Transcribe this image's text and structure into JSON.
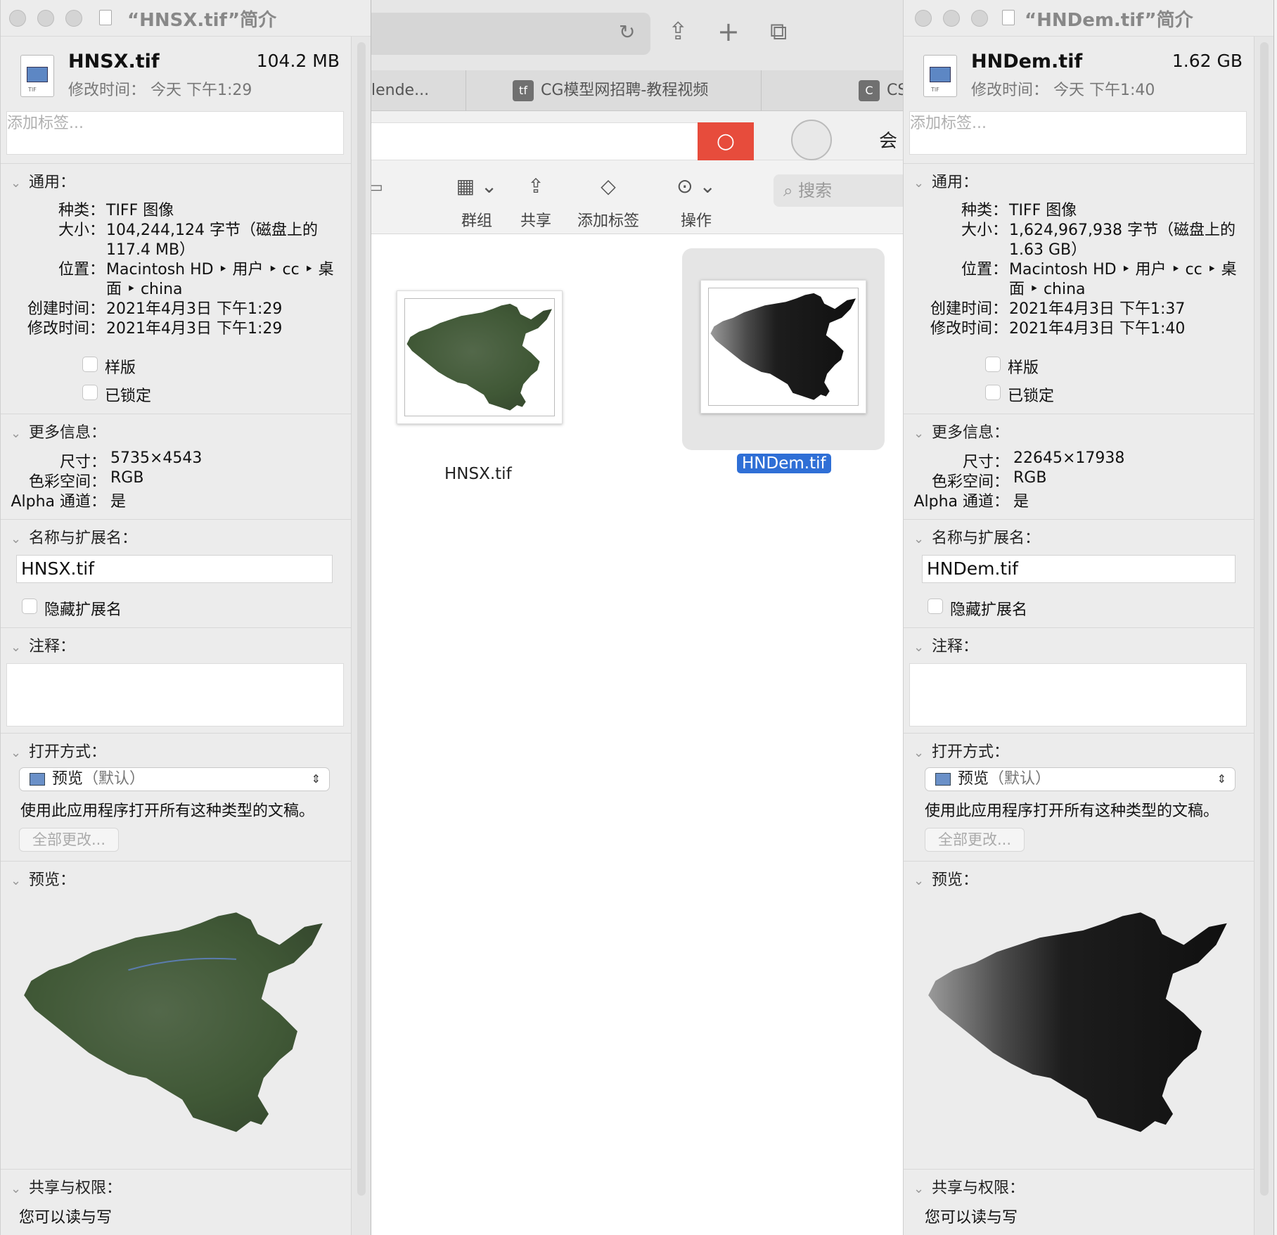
{
  "colors": {
    "window_bg": "#ececec",
    "selection_blue": "#2f6fd6",
    "search_red": "#e74c3c",
    "satellite_green": "#3f5a35",
    "dem_dark": "#151515"
  },
  "browser": {
    "tabs": [
      {
        "label": "lende...",
        "icon": "generic-tab"
      },
      {
        "label": "CG模型网招聘-教程视频",
        "icon": "cg-logo-icon"
      },
      {
        "label": "CS",
        "icon": "c-logo-icon"
      }
    ],
    "icons": [
      "reload-icon",
      "share-icon",
      "new-tab-icon",
      "tab-overview-icon"
    ],
    "web_header_text": "会"
  },
  "finder": {
    "toolbar": {
      "group": "群组",
      "share": "共享",
      "add_tag": "添加标签",
      "action": "操作",
      "search_placeholder": "搜索"
    },
    "files": [
      {
        "name": "HNSX.tif",
        "selected": false
      },
      {
        "name": "HNDem.tif",
        "selected": true
      }
    ]
  },
  "info_left": {
    "window_title": "“HNSX.tif”简介",
    "file_name": "HNSX.tif",
    "file_size": "104.2 MB",
    "modified_short": "修改时间： 今天 下午1:29",
    "tag_placeholder": "添加标签...",
    "general": {
      "header": "通用：",
      "kind_label": "种类：",
      "kind": "TIFF 图像",
      "size_label": "大小：",
      "size_line1": "104,244,124 字节（磁盘上的",
      "size_line2": "117.4 MB）",
      "where_label": "位置：",
      "where_line1": "Macintosh HD ‣ 用户 ‣ cc ‣ 桌",
      "where_line2": "面 ‣ china",
      "created_label": "创建时间：",
      "created": "2021年4月3日 下午1:29",
      "modified_label": "修改时间：",
      "modified": "2021年4月3日 下午1:29",
      "stationery": "样版",
      "locked": "已锁定"
    },
    "more": {
      "header": "更多信息：",
      "dim_label": "尺寸：",
      "dimensions": "5735×4543",
      "cs_label": "色彩空间：",
      "color_space": "RGB",
      "alpha_label": "Alpha 通道：",
      "alpha": "是"
    },
    "name_ext": {
      "header": "名称与扩展名：",
      "value": "HNSX.tif",
      "hide_ext": "隐藏扩展名"
    },
    "comments": {
      "header": "注释："
    },
    "open_with": {
      "header": "打开方式：",
      "app": "预览",
      "app_default": "（默认）",
      "note": "使用此应用程序打开所有这种类型的文稿。",
      "change_all": "全部更改..."
    },
    "preview": {
      "header": "预览："
    },
    "sharing": {
      "header": "共享与权限：",
      "note": "您可以读与写"
    }
  },
  "info_right": {
    "window_title": "“HNDem.tif”简介",
    "file_name": "HNDem.tif",
    "file_size": "1.62 GB",
    "modified_short": "修改时间： 今天 下午1:40",
    "tag_placeholder": "添加标签...",
    "general": {
      "header": "通用：",
      "kind_label": "种类：",
      "kind": "TIFF 图像",
      "size_label": "大小：",
      "size_line1": "1,624,967,938 字节（磁盘上的",
      "size_line2": "1.63 GB）",
      "where_label": "位置：",
      "where_line1": "Macintosh HD ‣ 用户 ‣ cc ‣ 桌",
      "where_line2": "面 ‣ china",
      "created_label": "创建时间：",
      "created": "2021年4月3日 下午1:37",
      "modified_label": "修改时间：",
      "modified": "2021年4月3日 下午1:40",
      "stationery": "样版",
      "locked": "已锁定"
    },
    "more": {
      "header": "更多信息：",
      "dim_label": "尺寸：",
      "dimensions": "22645×17938",
      "cs_label": "色彩空间：",
      "color_space": "RGB",
      "alpha_label": "Alpha 通道：",
      "alpha": "是"
    },
    "name_ext": {
      "header": "名称与扩展名：",
      "value": "HNDem.tif",
      "hide_ext": "隐藏扩展名"
    },
    "comments": {
      "header": "注释："
    },
    "open_with": {
      "header": "打开方式：",
      "app": "预览",
      "app_default": "（默认）",
      "note": "使用此应用程序打开所有这种类型的文稿。",
      "change_all": "全部更改..."
    },
    "preview": {
      "header": "预览："
    },
    "sharing": {
      "header": "共享与权限：",
      "note": "您可以读与写"
    }
  }
}
